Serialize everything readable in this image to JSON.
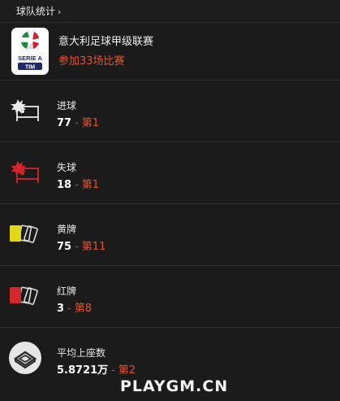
{
  "header": {
    "title": "球队统计",
    "chevron": "›"
  },
  "league": {
    "name": "意大利足球甲级联赛",
    "appearances": "参加33场比赛",
    "logo_name": "serie-a-tim-logo",
    "logo_text_top": "SERIE A",
    "logo_text_bottom": "TIM"
  },
  "stats": [
    {
      "label": "进球",
      "value": "77",
      "separator": "-",
      "rank": "第1",
      "icon": "goal-scored-icon"
    },
    {
      "label": "失球",
      "value": "18",
      "separator": "-",
      "rank": "第1",
      "icon": "goal-conceded-icon"
    },
    {
      "label": "黄牌",
      "value": "75",
      "separator": "-",
      "rank": "第11",
      "icon": "yellow-card-icon"
    },
    {
      "label": "红牌",
      "value": "3",
      "separator": "-",
      "rank": "第8",
      "icon": "red-card-icon"
    },
    {
      "label": "平均上座数",
      "value": "5.8721万",
      "separator": "-",
      "rank": "第2",
      "icon": "stadium-icon"
    }
  ],
  "colors": {
    "background": "#1b1b1b",
    "accent": "#e4542f",
    "yellow_card": "#e2d817",
    "red_card": "#d4262b"
  },
  "watermark": "PLAYGM.CN"
}
